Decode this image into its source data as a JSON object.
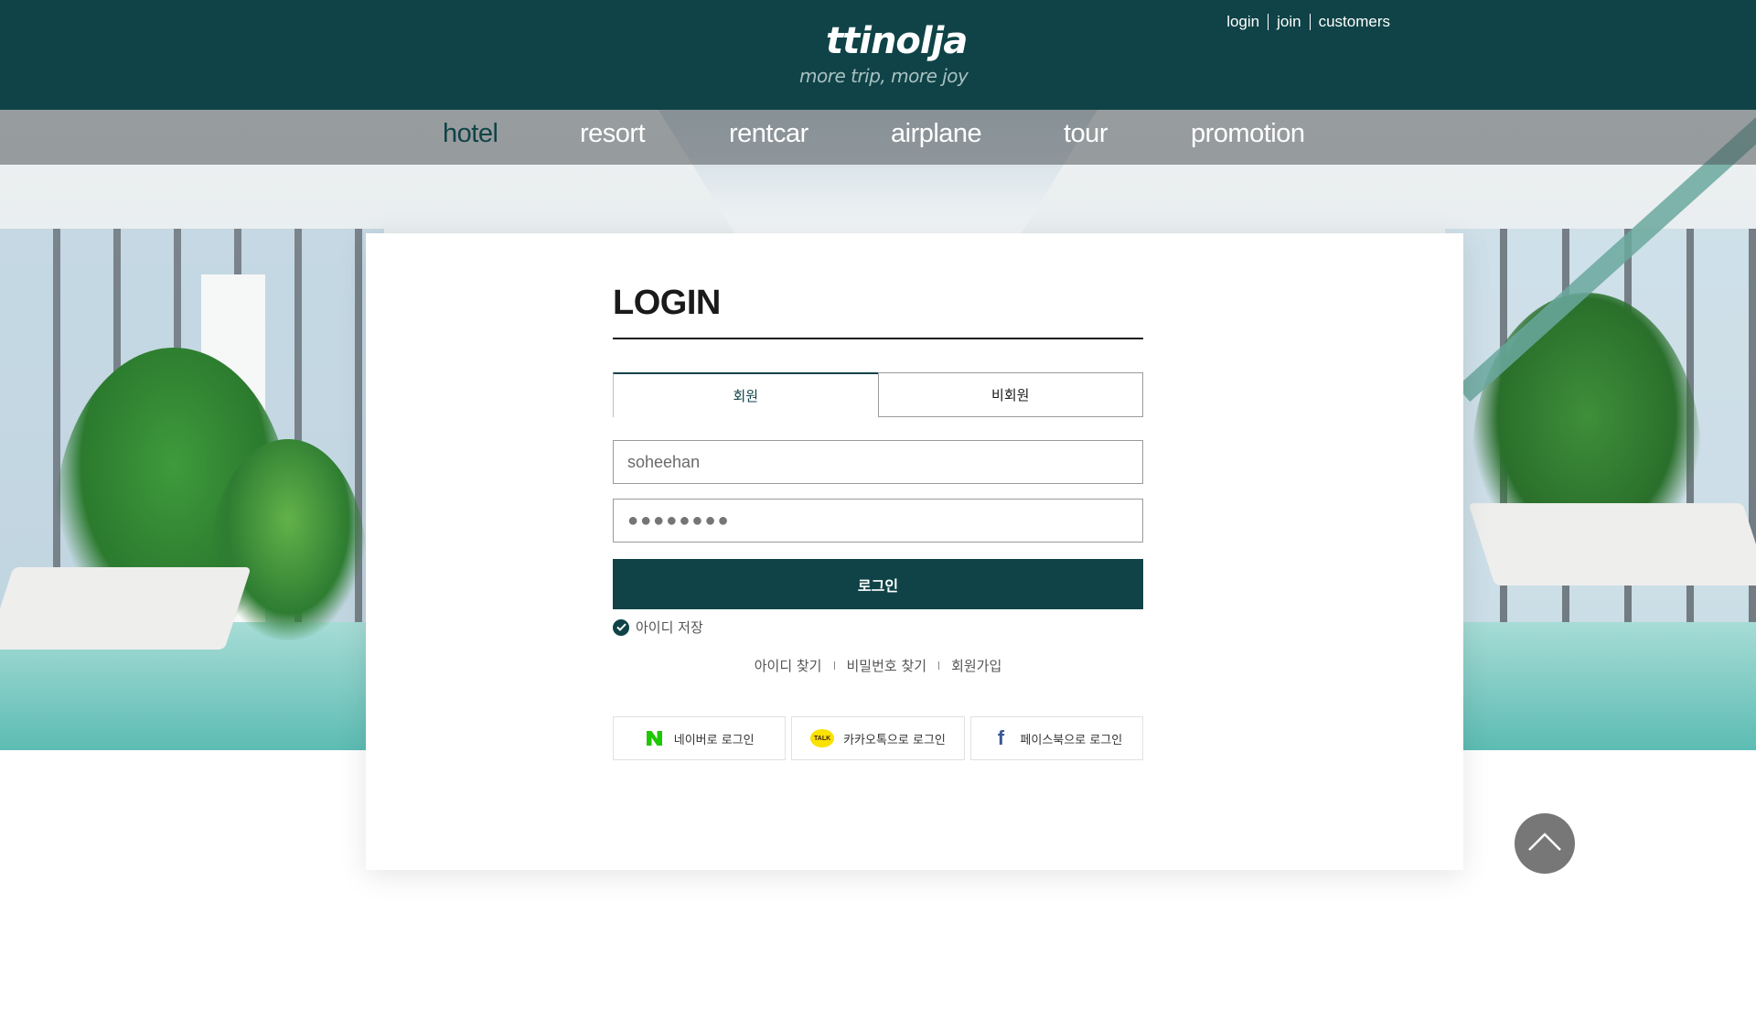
{
  "brand": {
    "logo": "ttinolja",
    "tagline": "more trip, more joy"
  },
  "util_links": [
    "login",
    "join",
    "customers"
  ],
  "nav": {
    "items": [
      "hotel",
      "resort",
      "rentcar",
      "airplane",
      "tour",
      "promotion"
    ],
    "active": "hotel"
  },
  "login": {
    "title": "LOGIN",
    "tabs": {
      "member": "회원",
      "guest": "비회원"
    },
    "id_value": "soheehan",
    "password_masked": "●●●●●●●●",
    "submit_label": "로그인",
    "save_id_label": "아이디 저장",
    "save_id_checked": true,
    "links": {
      "find_id": "아이디 찾기",
      "find_password": "비밀번호 찾기",
      "signup": "회원가입"
    },
    "social": {
      "naver": "네이버로 로그인",
      "kakao": "카카오톡으로 로그인",
      "kakao_badge": "TALK",
      "facebook": "페이스북으로 로그인"
    }
  },
  "colors": {
    "brand": "#0f4347",
    "naver": "#1ec800",
    "kakao": "#fae100",
    "facebook": "#3b5998"
  },
  "icons": [
    "naver-icon",
    "kakao-icon",
    "facebook-icon",
    "check-circle-icon",
    "chevron-up-icon"
  ]
}
